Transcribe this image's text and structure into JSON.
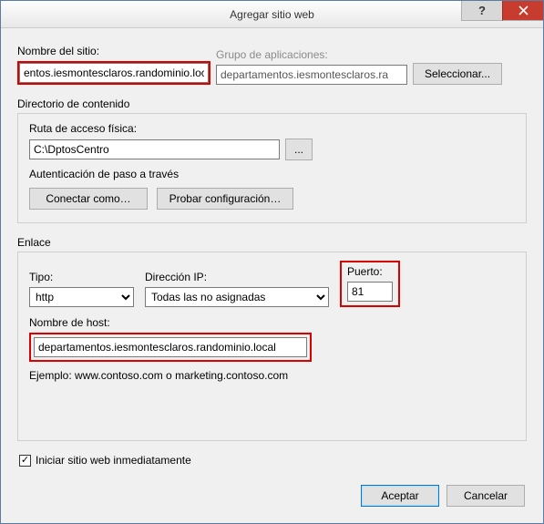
{
  "title": "Agregar sitio web",
  "labels": {
    "site_name": "Nombre del sitio:",
    "app_pool": "Grupo de aplicaciones:",
    "select_btn": "Seleccionar...",
    "content_dir": "Directorio de contenido",
    "physical_path": "Ruta de acceso física:",
    "auth_passthrough": "Autenticación de paso a través",
    "connect_as": "Conectar como…",
    "test_config": "Probar configuración…",
    "binding": "Enlace",
    "type": "Tipo:",
    "ip": "Dirección IP:",
    "port": "Puerto:",
    "hostname": "Nombre de host:",
    "example": "Ejemplo: www.contoso.com o marketing.contoso.com",
    "start_immediately": "Iniciar sitio web inmediatamente",
    "accept": "Aceptar",
    "cancel": "Cancelar",
    "browse": "..."
  },
  "values": {
    "site_name": "entos.iesmontesclaros.randominio.local",
    "app_pool": "departamentos.iesmontesclaros.ra",
    "physical_path": "C:\\DptosCentro",
    "type": "http",
    "ip": "Todas las no asignadas",
    "port": "81",
    "hostname": "departamentos.iesmontesclaros.randominio.local",
    "start_immediately_checked": "✓"
  },
  "colors": {
    "highlight": "#d90000",
    "close": "#c73c2e"
  }
}
